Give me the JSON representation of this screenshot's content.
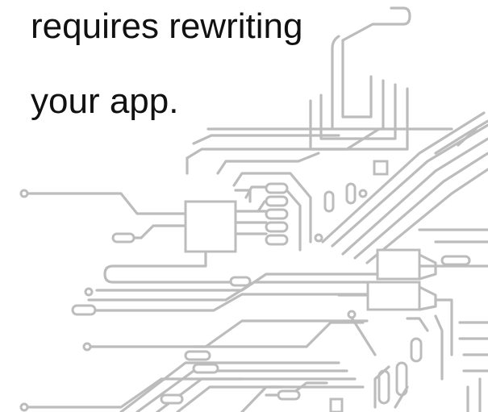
{
  "slide": {
    "caption_lines": [
      "requires rewriting",
      "your app."
    ]
  },
  "illustration": {
    "name": "circuit-board-traces",
    "trace_color": "#bcbcbc",
    "text_color": "#111111",
    "background": "#ffffff"
  }
}
